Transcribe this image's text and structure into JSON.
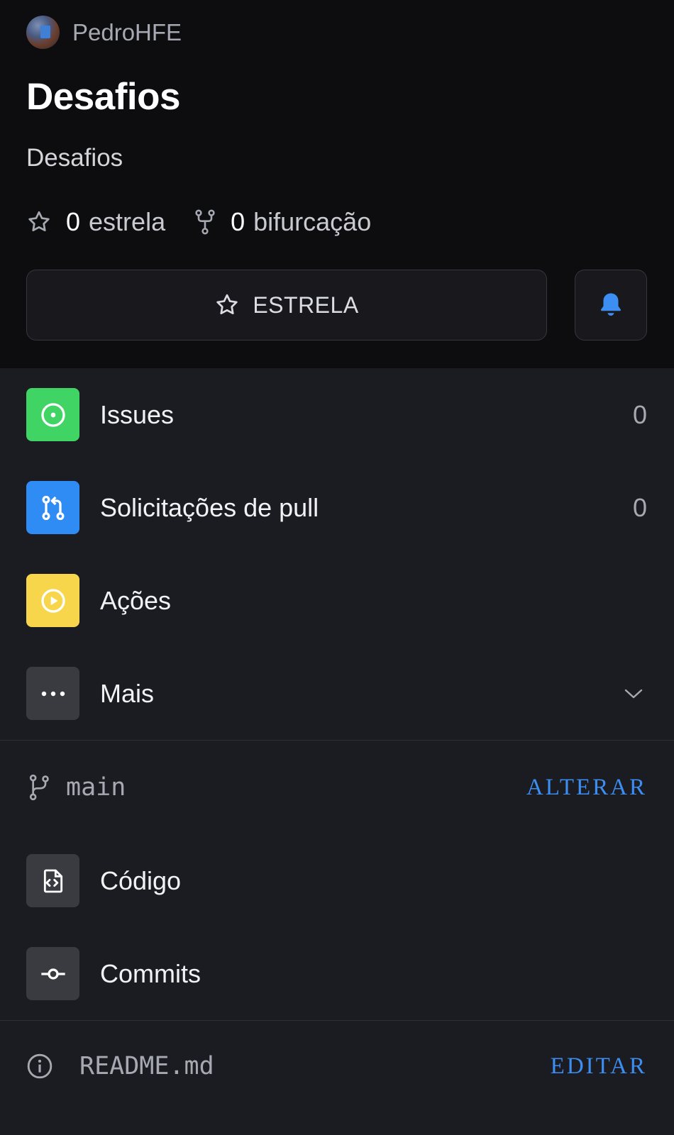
{
  "repo": {
    "owner": "PedroHFE",
    "title": "Desafios",
    "description": "Desafios",
    "stars_count": "0",
    "stars_label": "estrela",
    "forks_count": "0",
    "forks_label": "bifurcação",
    "star_button_label": "ESTRELA"
  },
  "menu": {
    "items": [
      {
        "label": "Issues",
        "count": "0",
        "icon": "issue-opened-icon",
        "color": "#3fd463"
      },
      {
        "label": "Solicitações de pull",
        "count": "0",
        "icon": "git-pull-request-icon",
        "color": "#2f8cf5"
      },
      {
        "label": "Ações",
        "icon": "play-icon",
        "color": "#f7d64b"
      },
      {
        "label": "Mais",
        "icon": "kebab-horizontal-icon",
        "color": "#3a3b41"
      }
    ]
  },
  "branch": {
    "name": "main",
    "action_label": "ALTERAR"
  },
  "code_items": [
    {
      "label": "Código",
      "icon": "file-code-icon"
    },
    {
      "label": "Commits",
      "icon": "git-commit-icon"
    }
  ],
  "readme": {
    "filename": "README.md",
    "action_label": "EDITAR"
  },
  "colors": {
    "accent": "#3d8ef2",
    "background": "#1b1c21",
    "header_background": "#0d0d10"
  }
}
